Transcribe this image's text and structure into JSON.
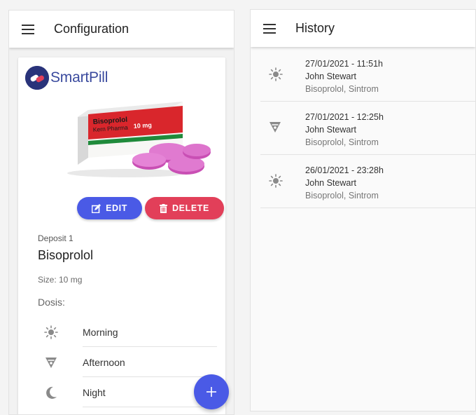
{
  "config": {
    "title": "Configuration",
    "logo_text": "SmartPill",
    "buttons": {
      "edit": "EDIT",
      "delete": "DELETE"
    },
    "deposit_label": "Deposit 1",
    "drug_name": "Bisoprolol",
    "size_label": "Size: 10 mg",
    "dosis_label": "Dosis:",
    "doses": [
      {
        "label": "Morning",
        "icon": "sun-icon"
      },
      {
        "label": "Afternoon",
        "icon": "afternoon-icon"
      },
      {
        "label": "Night",
        "icon": "moon-icon"
      }
    ],
    "fab_icon": "plus-icon",
    "product_box": {
      "name": "Bisoprolol",
      "brand": "Kern Pharma",
      "dose": "10 mg"
    }
  },
  "history": {
    "title": "History",
    "items": [
      {
        "date": "27/01/2021 - 11:51h",
        "user": "John Stewart",
        "meds": "Bisoprolol, Sintrom",
        "icon": "sun-icon"
      },
      {
        "date": "27/01/2021 - 12:25h",
        "user": "John Stewart",
        "meds": "Bisoprolol, Sintrom",
        "icon": "afternoon-icon"
      },
      {
        "date": "26/01/2021 - 23:28h",
        "user": "John Stewart",
        "meds": "Bisoprolol, Sintrom",
        "icon": "sun-icon"
      }
    ]
  },
  "colors": {
    "primary": "#4a5ae6",
    "danger": "#e23f59",
    "logo_dark": "#29337a",
    "logo_text": "#3a4a9e"
  }
}
